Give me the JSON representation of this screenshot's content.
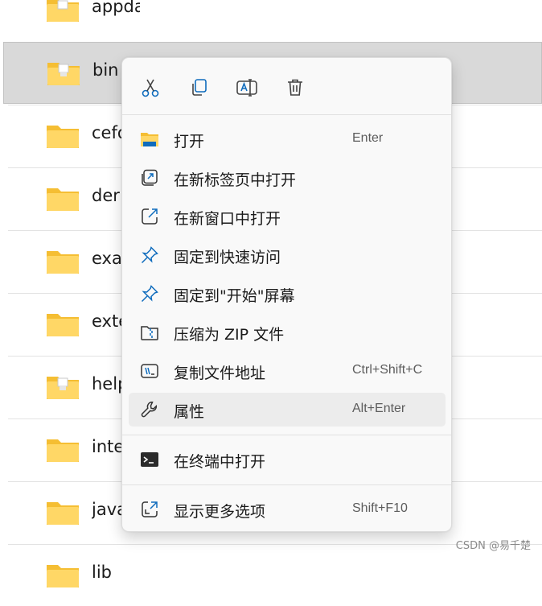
{
  "files": [
    {
      "name": "appdata",
      "icon": "folder-with-file-icon"
    },
    {
      "name": "bin",
      "icon": "folder-with-file-icon",
      "selected": true
    },
    {
      "name": "cefo",
      "icon": "folder-icon"
    },
    {
      "name": "der",
      "icon": "folder-icon"
    },
    {
      "name": "exa",
      "icon": "folder-icon"
    },
    {
      "name": "exte",
      "icon": "folder-icon"
    },
    {
      "name": "help",
      "icon": "folder-with-file-icon"
    },
    {
      "name": "inte",
      "icon": "folder-icon"
    },
    {
      "name": "java",
      "icon": "folder-icon"
    },
    {
      "name": "lib",
      "icon": "folder-icon"
    }
  ],
  "context_menu": {
    "toolbar": [
      {
        "name": "cut-icon"
      },
      {
        "name": "copy-icon"
      },
      {
        "name": "rename-icon"
      },
      {
        "name": "delete-icon"
      }
    ],
    "items": [
      {
        "label": "打开",
        "shortcut": "Enter",
        "icon": "open-folder-icon"
      },
      {
        "label": "在新标签页中打开",
        "shortcut": "",
        "icon": "new-tab-icon"
      },
      {
        "label": "在新窗口中打开",
        "shortcut": "",
        "icon": "new-window-icon"
      },
      {
        "label": "固定到快速访问",
        "shortcut": "",
        "icon": "pin-icon"
      },
      {
        "label": "固定到\"开始\"屏幕",
        "shortcut": "",
        "icon": "pin-start-icon"
      },
      {
        "label": "压缩为 ZIP 文件",
        "shortcut": "",
        "icon": "zip-icon"
      },
      {
        "label": "复制文件地址",
        "shortcut": "Ctrl+Shift+C",
        "icon": "copy-path-icon"
      },
      {
        "label": "属性",
        "shortcut": "Alt+Enter",
        "icon": "properties-wrench-icon"
      },
      {
        "label": "在终端中打开",
        "shortcut": "",
        "icon": "terminal-icon"
      },
      {
        "label": "显示更多选项",
        "shortcut": "Shift+F10",
        "icon": "more-options-icon"
      }
    ]
  },
  "watermark": "CSDN @易千楚",
  "colors": {
    "accent": "#0f6cbd",
    "folder": "#f8c94a",
    "selection": "#d9d9d9"
  }
}
